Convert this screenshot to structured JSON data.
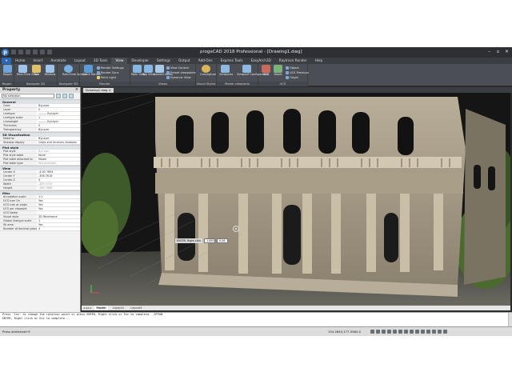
{
  "app": {
    "logo": "p",
    "title": "progeCAD 2018 Professional - [Drawing1.dwg]"
  },
  "ribbon_tabs": [
    "Home",
    "Insert",
    "Annotate",
    "Layout",
    "3D Tools",
    "View",
    "Developer",
    "Settings",
    "Output",
    "Add-Ons",
    "Express Tools",
    "EasyArch3D",
    "Raytrace Render",
    "Help"
  ],
  "ribbon_active_tab": "View",
  "ribbon": {
    "groups": [
      {
        "title": "Regen",
        "buttons": [
          "Regen"
        ]
      },
      {
        "title": "Navigate 2D",
        "buttons": [
          "Real-Time Zoom",
          "Pan",
          "Window"
        ]
      },
      {
        "title": "Navigate 3D",
        "buttons": [
          "Real-Time Sphere"
        ]
      },
      {
        "title": "Render",
        "buttons": [
          "Quick Render"
        ],
        "small": [
          "Render Settings",
          "Render Sync",
          "Point Light"
        ]
      },
      {
        "title": "Views",
        "buttons": [
          "Main View",
          "Top View",
          "Named Views"
        ],
        "small": [
          "View Control",
          "Preset viewpoints",
          "Dynamic View"
        ]
      },
      {
        "title": "Visual Styles",
        "buttons": [
          "Conceptual"
        ]
      },
      {
        "title": "Model viewports",
        "buttons": [
          "Viewports",
          "Viewport Configuration"
        ]
      },
      {
        "title": "UCS",
        "buttons": [
          "UCS",
          "World"
        ],
        "small": [
          "Object",
          "UCS Previous",
          "Origin"
        ]
      }
    ]
  },
  "property_panel": {
    "title": "Property",
    "close": "×",
    "selection": "No selection",
    "sections": [
      {
        "name": "General",
        "rows": [
          {
            "k": "Color",
            "v": "ByLayer"
          },
          {
            "k": "Layer",
            "v": "0"
          },
          {
            "k": "Linetype",
            "v": "——— ByLayer"
          },
          {
            "k": "Linetype scale",
            "v": "1"
          },
          {
            "k": "Lineweight",
            "v": "——— ByLayer"
          },
          {
            "k": "Thickness",
            "v": "0"
          },
          {
            "k": "Transparency",
            "v": "ByLayer"
          }
        ]
      },
      {
        "name": "3D Visualization",
        "rows": [
          {
            "k": "Material",
            "v": "ByLayer"
          },
          {
            "k": "Shadow display",
            "v": "Casts and receives shadows"
          }
        ]
      },
      {
        "name": "Plot style",
        "rows": [
          {
            "k": "Plot style",
            "v": "ByColor",
            "gray": true
          },
          {
            "k": "Plot style table",
            "v": "None"
          },
          {
            "k": "Plot table attached to",
            "v": "Model"
          },
          {
            "k": "Plot table type",
            "v": "Not available",
            "gray": true
          }
        ]
      },
      {
        "name": "View",
        "rows": [
          {
            "k": "Center X",
            "v": "-4.00 7894"
          },
          {
            "k": "Center Y",
            "v": "-306.7618"
          },
          {
            "k": "Center Z",
            "v": "0"
          },
          {
            "k": "Width",
            "v": "-483.0755",
            "gray": true
          },
          {
            "k": "Height",
            "v": "-289.7886",
            "gray": true
          }
        ]
      },
      {
        "name": "Misc",
        "rows": [
          {
            "k": "Annotation scale",
            "v": "1:1"
          },
          {
            "k": "UCS icon On",
            "v": "Yes"
          },
          {
            "k": "UCS icon at origin",
            "v": "Yes"
          },
          {
            "k": "UCS per viewport",
            "v": "Yes"
          },
          {
            "k": "UCS Name",
            "v": ""
          },
          {
            "k": "Visual style",
            "v": "2D Wireframe"
          },
          {
            "k": "Global linetype scale",
            "v": "1"
          },
          {
            "k": "Sk area",
            "v": "Yes"
          },
          {
            "k": "Number of decimal places",
            "v": "4"
          }
        ]
      }
    ]
  },
  "document": {
    "tab": "Drawing1.dwg",
    "tab_close": "×"
  },
  "drawing": {
    "dyn_prompt": "ENTER, Right click",
    "dyn_value_1": "1,895",
    "dyn_value_2": "0,06"
  },
  "layout_tabs": {
    "arrows": "◂ ◂ ▸ ▸",
    "tabs": [
      "Model",
      "Layout1",
      "Layout2"
    ],
    "active": "Model"
  },
  "command": {
    "lines": [
      "Press 'Ins' to change the rotation point or press ENTER, Right click or Esc to complete. _RTPAN",
      "ENTER, Right click or Esc to complete..."
    ]
  },
  "status": {
    "left": "Press stretched+E",
    "coords": "154.2843,177.5984,0"
  },
  "colors": {
    "accent": "#2e67b1",
    "ribbon": "#4b4f55",
    "background": "#151515"
  }
}
